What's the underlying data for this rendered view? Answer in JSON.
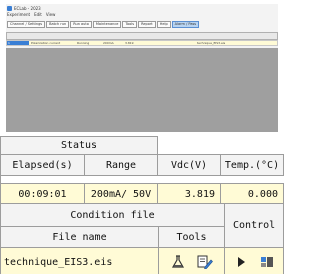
{
  "window": {
    "title": "ECLab - 2023",
    "menu": [
      "Experiment",
      "Edit",
      "View"
    ]
  },
  "toolbar": {
    "buttons": [
      "Channel / Settings",
      "Batch run",
      "Run auto",
      "Maintenance",
      "Tools",
      "Report",
      "Help",
      "Alarm / Pass"
    ]
  },
  "mini_row": {
    "id": "1",
    "name": "Polarization current",
    "status": "Running",
    "range": "200mA",
    "voltage": "3.819",
    "file": "technique_EIS3.eis"
  },
  "status_panel": {
    "title": "Status",
    "columns": [
      "Elapsed(s)",
      "Range",
      "Vdc(V)",
      "Temp.(°C)"
    ],
    "values": [
      "00:09:01",
      "200mA/ 50V",
      "3.819",
      "0.000"
    ]
  },
  "condition_panel": {
    "title": "Condition file",
    "file_name_header": "File name",
    "tools_header": "Tools",
    "control_header": "Control",
    "file_name": "technique_EIS3.eis"
  },
  "icons": {
    "tool1": "flask-icon",
    "tool2": "edit-document-icon",
    "control1": "play-icon",
    "control2": "stop-icon"
  }
}
